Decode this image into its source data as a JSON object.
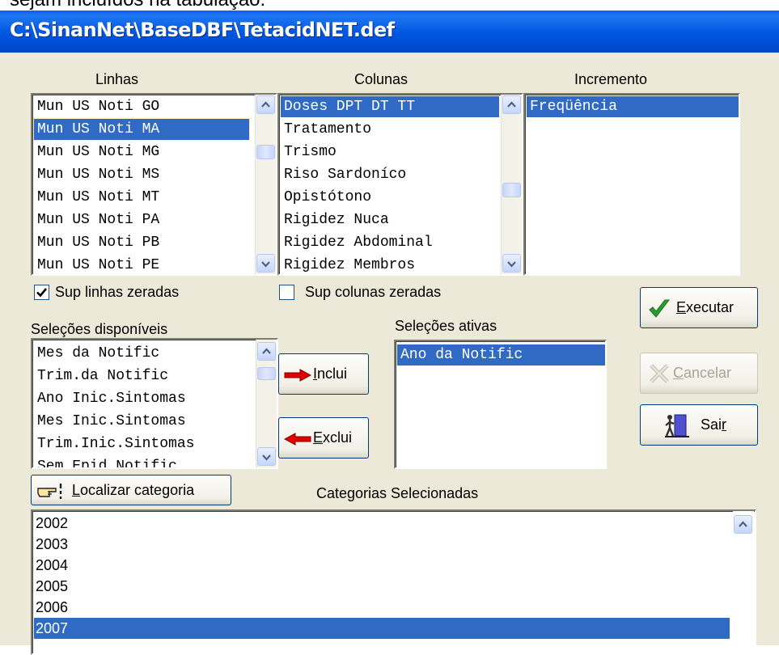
{
  "document": {
    "text": "sejam incluídos na tabulação:"
  },
  "window": {
    "title": "C:\\SinanNet\\BaseDBF\\TetacidNET.def"
  },
  "labels": {
    "linhas": "Linhas",
    "colunas": "Colunas",
    "incremento": "Incremento",
    "selecoes_disponiveis": "Seleções disponíveis",
    "selecoes_ativas": "Seleções ativas",
    "categorias_selecionadas": "Categorias Selecionadas"
  },
  "linhas": {
    "items": [
      "Mun US Noti GO",
      "Mun US Noti MA",
      "Mun US Noti MG",
      "Mun US Noti MS",
      "Mun US Noti MT",
      "Mun US Noti PA",
      "Mun US Noti PB",
      "Mun US Noti PE"
    ],
    "selected": "Mun US Noti MA"
  },
  "colunas": {
    "items": [
      "Doses DPT DT TT",
      "Tratamento",
      "Trismo",
      "Riso Sardoníco",
      "Opistótono",
      "Rigidez Nuca",
      "Rigidez Abdominal",
      "Rigidez Membros"
    ],
    "selected": "Doses DPT DT TT"
  },
  "incremento": {
    "items": [
      "Freqüência"
    ],
    "selected": "Freqüência"
  },
  "checkboxes": {
    "sup_linhas": {
      "label": "Sup linhas zeradas",
      "checked": true
    },
    "sup_colunas": {
      "label": "Sup colunas zeradas",
      "checked": false
    }
  },
  "selecoes_disponiveis": {
    "items": [
      "Mes da Notific",
      "Trim.da Notific",
      "Ano Inic.Sintomas",
      "Mes Inic.Sintomas",
      "Trim.Inic.Sintomas",
      "Sem.Epid.Notific"
    ]
  },
  "selecoes_ativas": {
    "items": [
      "Ano da Notific"
    ],
    "selected": "Ano da Notific"
  },
  "buttons": {
    "inclui": {
      "pre": "",
      "accel": "I",
      "post": "nclui"
    },
    "exclui": {
      "pre": "",
      "accel": "E",
      "post": "xclui"
    },
    "executar": {
      "pre": "",
      "accel": "E",
      "post": "xecutar"
    },
    "cancelar": {
      "pre": "",
      "accel": "C",
      "post": "ancelar",
      "disabled": true
    },
    "sair": {
      "pre": "Sai",
      "accel": "r",
      "post": ""
    },
    "localizar": {
      "pre": "",
      "accel": "L",
      "post": "ocalizar categoria"
    }
  },
  "categorias": {
    "items": [
      "2002",
      "2003",
      "2004",
      "2005",
      "2006",
      "2007"
    ],
    "selected": "2007"
  },
  "icons": {
    "executar": "check-icon",
    "cancelar": "x-icon",
    "sair": "exit-door-icon",
    "inclui": "arrow-right-icon",
    "exclui": "arrow-left-icon",
    "localizar": "pointing-hand-icon"
  },
  "colors": {
    "title_bar": "#0055e5",
    "selection": "#316ac5",
    "window_bg": "#ece9d8",
    "check_green": "#2a9e2a",
    "arrow_red": "#e00000"
  }
}
